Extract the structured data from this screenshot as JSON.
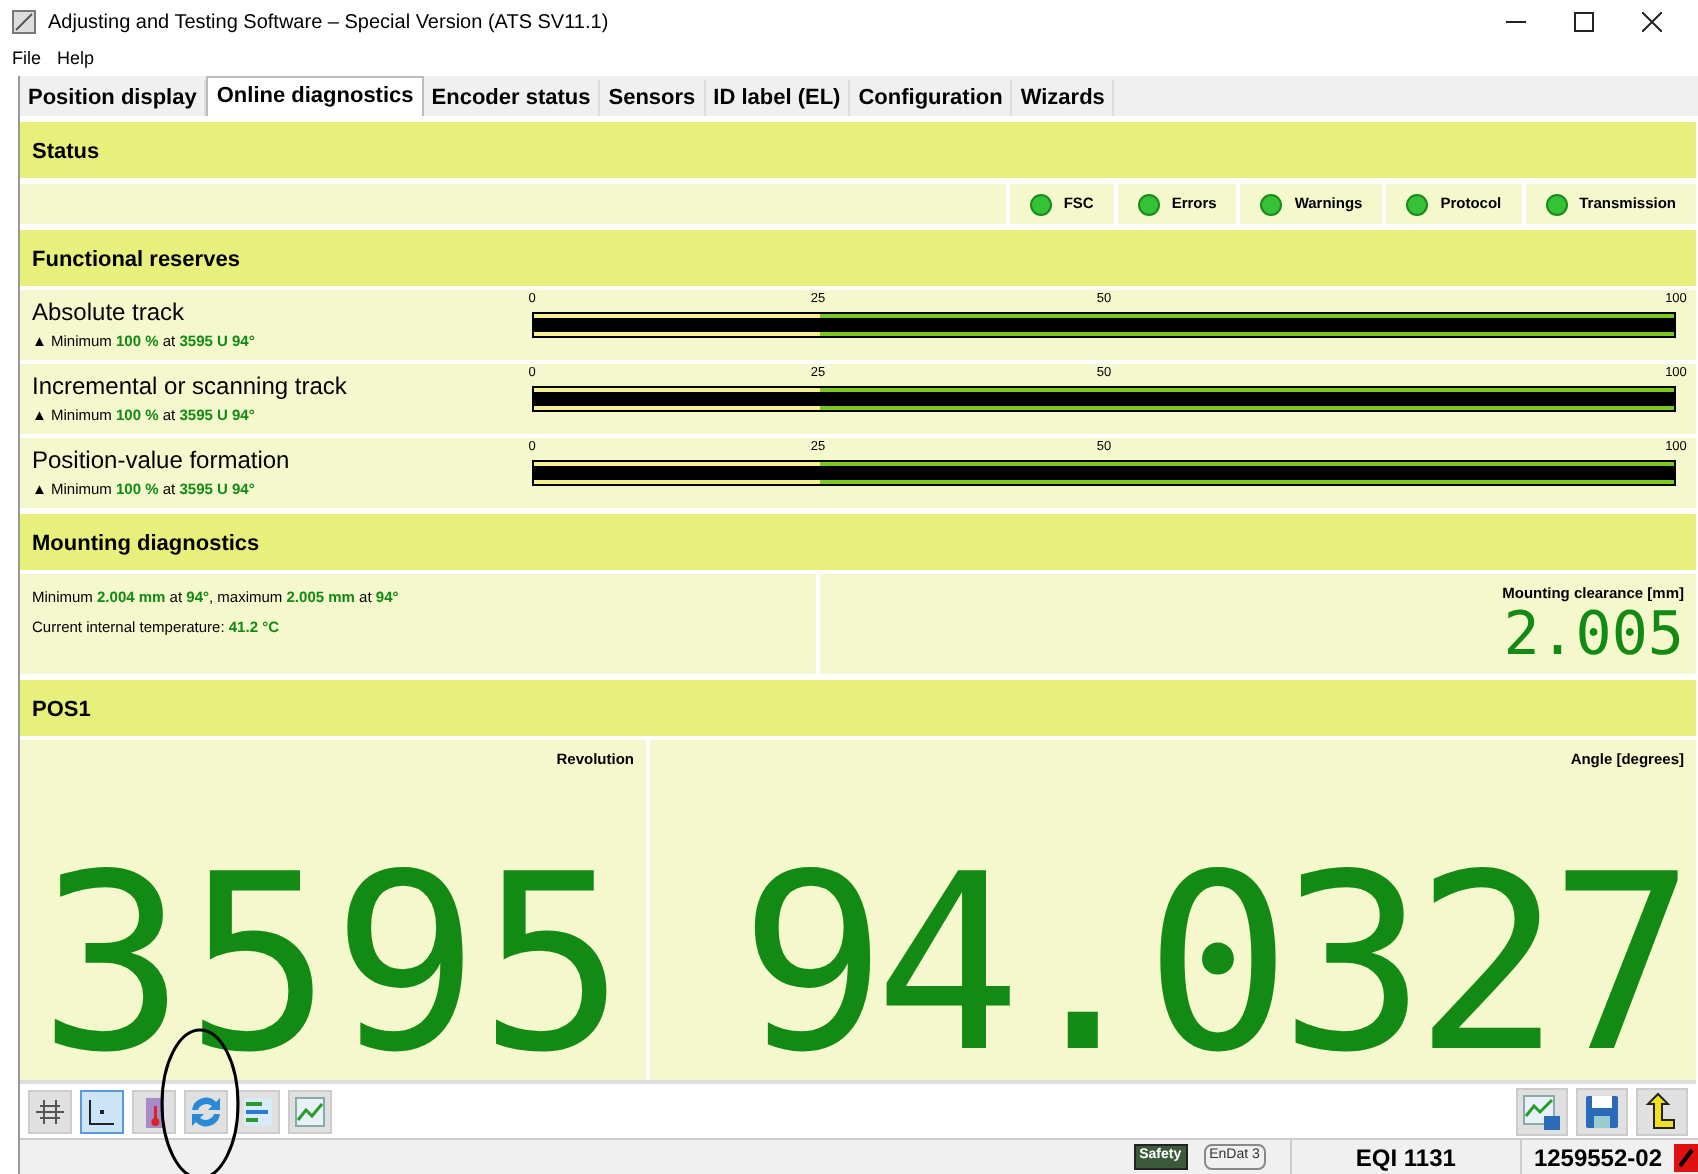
{
  "window": {
    "title": "Adjusting and Testing Software – Special Version (ATS SV11.1)"
  },
  "menu": [
    "File",
    "Help"
  ],
  "tabs": [
    {
      "label": "Position display",
      "selected": false
    },
    {
      "label": "Online diagnostics",
      "selected": true
    },
    {
      "label": "Encoder status",
      "selected": false
    },
    {
      "label": "Sensors",
      "selected": false
    },
    {
      "label": "ID label (EL)",
      "selected": false
    },
    {
      "label": "Configuration",
      "selected": false
    },
    {
      "label": "Wizards",
      "selected": false
    }
  ],
  "status": {
    "title": "Status",
    "indicators": [
      {
        "label": "FSC",
        "on": true
      },
      {
        "label": "Errors",
        "on": true
      },
      {
        "label": "Warnings",
        "on": true
      },
      {
        "label": "Protocol",
        "on": true
      },
      {
        "label": "Transmission",
        "on": true
      }
    ]
  },
  "functional_reserves": {
    "title": "Functional reserves",
    "rows": [
      {
        "name": "Absolute track",
        "minimum": "▲ Minimum **100 %** at **3595 U 94°**",
        "ticks": [
          "0",
          "25",
          "50",
          "100"
        ],
        "level": 1
      },
      {
        "name": "Incremental or scanning track",
        "minimum": "▲ Minimum **100 %** at **3595 U 94°**",
        "ticks": [
          "0",
          "25",
          "50",
          "100"
        ],
        "level": 1
      },
      {
        "name": "Position-value formation",
        "minimum": "▲ Minimum **100 %** at **3595 U 94°**",
        "ticks": [
          "0",
          "25",
          "50",
          "100"
        ],
        "level": 1
      }
    ]
  },
  "mounting": {
    "title": "Mounting diagnostics",
    "lines": [
      "Minimum **2.004 mm** at **94°**, maximum **2.005 mm** at **94°**",
      "Current internal temperature: **41.2 °C**"
    ],
    "clearance_label": "Mounting clearance [mm]",
    "clearance_value": "2.005"
  },
  "pos1": {
    "title": "POS1",
    "revolution_label": "Revolution",
    "revolution": "3595",
    "angle_label": "Angle [degrees]",
    "angle": "94.0327"
  },
  "toolbar": {
    "left": [
      {
        "kind": "grid",
        "selected": false
      },
      {
        "kind": "axes",
        "selected": true
      },
      {
        "kind": "temperature",
        "selected": false
      },
      {
        "kind": "refresh",
        "selected": false
      },
      {
        "kind": "bars",
        "selected": false
      },
      {
        "kind": "chart",
        "selected": false
      }
    ],
    "right": [
      {
        "kind": "chart-save"
      },
      {
        "kind": "save"
      },
      {
        "kind": "exit"
      }
    ]
  },
  "status_bar": {
    "safety_badge": "Safety",
    "endat_badge": "EnDat 3",
    "device": "EQI 1131",
    "serial": "1259552-02"
  }
}
